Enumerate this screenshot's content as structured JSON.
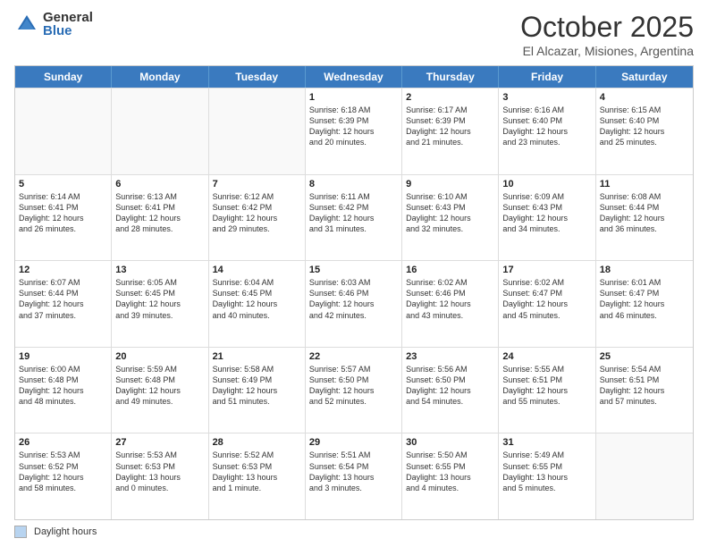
{
  "logo": {
    "general": "General",
    "blue": "Blue"
  },
  "header": {
    "month": "October 2025",
    "location": "El Alcazar, Misiones, Argentina"
  },
  "weekdays": [
    "Sunday",
    "Monday",
    "Tuesday",
    "Wednesday",
    "Thursday",
    "Friday",
    "Saturday"
  ],
  "rows": [
    [
      {
        "day": "",
        "text": ""
      },
      {
        "day": "",
        "text": ""
      },
      {
        "day": "",
        "text": ""
      },
      {
        "day": "1",
        "text": "Sunrise: 6:18 AM\nSunset: 6:39 PM\nDaylight: 12 hours\nand 20 minutes."
      },
      {
        "day": "2",
        "text": "Sunrise: 6:17 AM\nSunset: 6:39 PM\nDaylight: 12 hours\nand 21 minutes."
      },
      {
        "day": "3",
        "text": "Sunrise: 6:16 AM\nSunset: 6:40 PM\nDaylight: 12 hours\nand 23 minutes."
      },
      {
        "day": "4",
        "text": "Sunrise: 6:15 AM\nSunset: 6:40 PM\nDaylight: 12 hours\nand 25 minutes."
      }
    ],
    [
      {
        "day": "5",
        "text": "Sunrise: 6:14 AM\nSunset: 6:41 PM\nDaylight: 12 hours\nand 26 minutes."
      },
      {
        "day": "6",
        "text": "Sunrise: 6:13 AM\nSunset: 6:41 PM\nDaylight: 12 hours\nand 28 minutes."
      },
      {
        "day": "7",
        "text": "Sunrise: 6:12 AM\nSunset: 6:42 PM\nDaylight: 12 hours\nand 29 minutes."
      },
      {
        "day": "8",
        "text": "Sunrise: 6:11 AM\nSunset: 6:42 PM\nDaylight: 12 hours\nand 31 minutes."
      },
      {
        "day": "9",
        "text": "Sunrise: 6:10 AM\nSunset: 6:43 PM\nDaylight: 12 hours\nand 32 minutes."
      },
      {
        "day": "10",
        "text": "Sunrise: 6:09 AM\nSunset: 6:43 PM\nDaylight: 12 hours\nand 34 minutes."
      },
      {
        "day": "11",
        "text": "Sunrise: 6:08 AM\nSunset: 6:44 PM\nDaylight: 12 hours\nand 36 minutes."
      }
    ],
    [
      {
        "day": "12",
        "text": "Sunrise: 6:07 AM\nSunset: 6:44 PM\nDaylight: 12 hours\nand 37 minutes."
      },
      {
        "day": "13",
        "text": "Sunrise: 6:05 AM\nSunset: 6:45 PM\nDaylight: 12 hours\nand 39 minutes."
      },
      {
        "day": "14",
        "text": "Sunrise: 6:04 AM\nSunset: 6:45 PM\nDaylight: 12 hours\nand 40 minutes."
      },
      {
        "day": "15",
        "text": "Sunrise: 6:03 AM\nSunset: 6:46 PM\nDaylight: 12 hours\nand 42 minutes."
      },
      {
        "day": "16",
        "text": "Sunrise: 6:02 AM\nSunset: 6:46 PM\nDaylight: 12 hours\nand 43 minutes."
      },
      {
        "day": "17",
        "text": "Sunrise: 6:02 AM\nSunset: 6:47 PM\nDaylight: 12 hours\nand 45 minutes."
      },
      {
        "day": "18",
        "text": "Sunrise: 6:01 AM\nSunset: 6:47 PM\nDaylight: 12 hours\nand 46 minutes."
      }
    ],
    [
      {
        "day": "19",
        "text": "Sunrise: 6:00 AM\nSunset: 6:48 PM\nDaylight: 12 hours\nand 48 minutes."
      },
      {
        "day": "20",
        "text": "Sunrise: 5:59 AM\nSunset: 6:48 PM\nDaylight: 12 hours\nand 49 minutes."
      },
      {
        "day": "21",
        "text": "Sunrise: 5:58 AM\nSunset: 6:49 PM\nDaylight: 12 hours\nand 51 minutes."
      },
      {
        "day": "22",
        "text": "Sunrise: 5:57 AM\nSunset: 6:50 PM\nDaylight: 12 hours\nand 52 minutes."
      },
      {
        "day": "23",
        "text": "Sunrise: 5:56 AM\nSunset: 6:50 PM\nDaylight: 12 hours\nand 54 minutes."
      },
      {
        "day": "24",
        "text": "Sunrise: 5:55 AM\nSunset: 6:51 PM\nDaylight: 12 hours\nand 55 minutes."
      },
      {
        "day": "25",
        "text": "Sunrise: 5:54 AM\nSunset: 6:51 PM\nDaylight: 12 hours\nand 57 minutes."
      }
    ],
    [
      {
        "day": "26",
        "text": "Sunrise: 5:53 AM\nSunset: 6:52 PM\nDaylight: 12 hours\nand 58 minutes."
      },
      {
        "day": "27",
        "text": "Sunrise: 5:53 AM\nSunset: 6:53 PM\nDaylight: 13 hours\nand 0 minutes."
      },
      {
        "day": "28",
        "text": "Sunrise: 5:52 AM\nSunset: 6:53 PM\nDaylight: 13 hours\nand 1 minute."
      },
      {
        "day": "29",
        "text": "Sunrise: 5:51 AM\nSunset: 6:54 PM\nDaylight: 13 hours\nand 3 minutes."
      },
      {
        "day": "30",
        "text": "Sunrise: 5:50 AM\nSunset: 6:55 PM\nDaylight: 13 hours\nand 4 minutes."
      },
      {
        "day": "31",
        "text": "Sunrise: 5:49 AM\nSunset: 6:55 PM\nDaylight: 13 hours\nand 5 minutes."
      },
      {
        "day": "",
        "text": ""
      }
    ]
  ],
  "legend": {
    "label": "Daylight hours"
  }
}
